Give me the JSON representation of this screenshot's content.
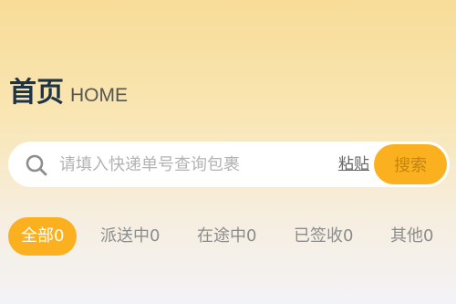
{
  "header": {
    "title": "首页",
    "subtitle": "HOME"
  },
  "search": {
    "placeholder": "请填入快递单号查询包裹",
    "value": "",
    "icon": "search-icon",
    "paste_label": "粘贴",
    "button_label": "搜索"
  },
  "tabs": [
    {
      "label": "全部0",
      "active": true
    },
    {
      "label": "派送中0",
      "active": false
    },
    {
      "label": "在途中0",
      "active": false
    },
    {
      "label": "已签收0",
      "active": false
    },
    {
      "label": "其他0",
      "active": false
    }
  ],
  "colors": {
    "accent": "#fbb11f",
    "title": "#1e3346",
    "tab_inactive": "#8c8c8c"
  }
}
